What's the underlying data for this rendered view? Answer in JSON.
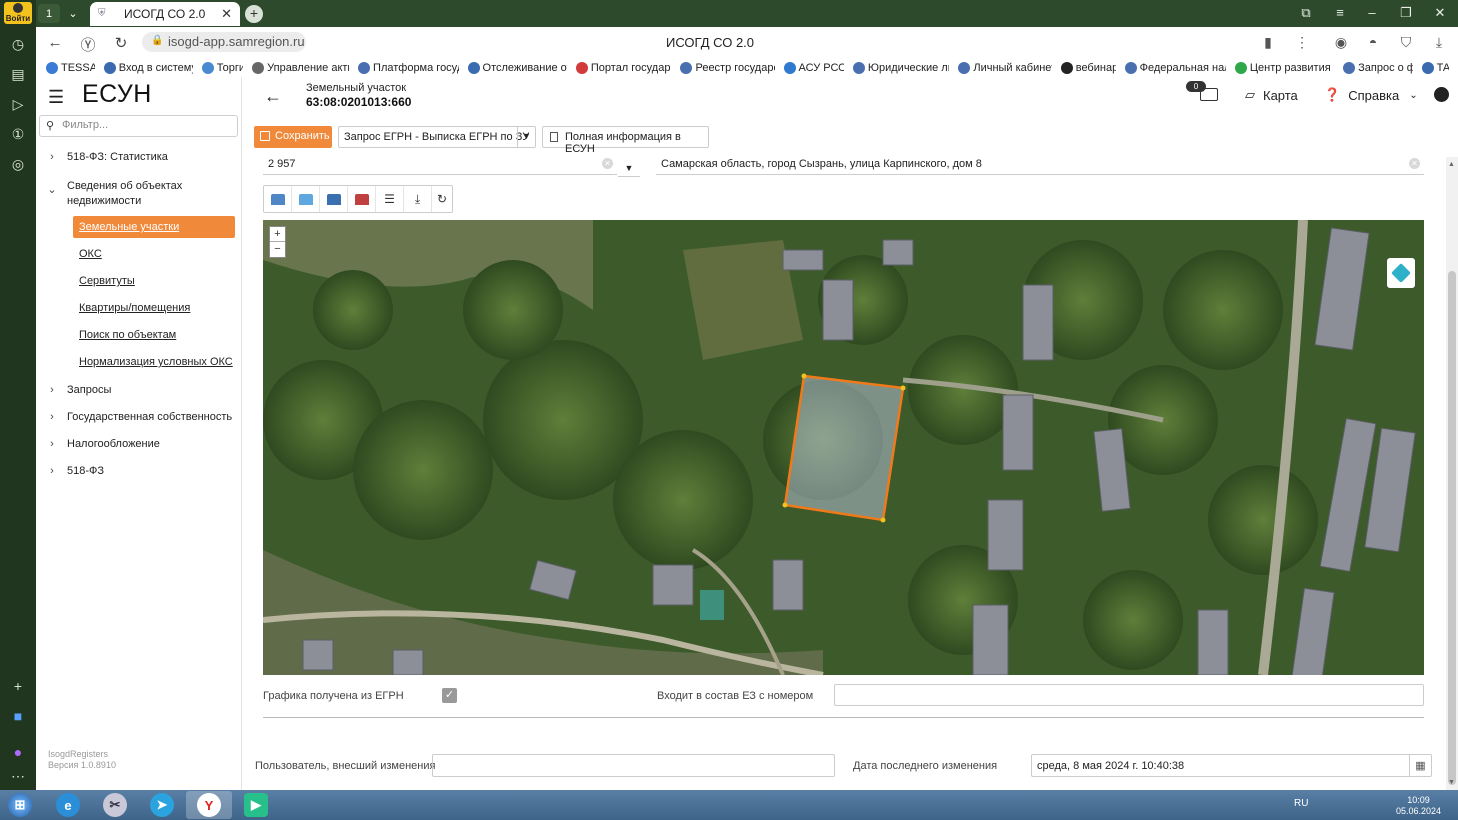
{
  "browser": {
    "login_label": "Войти",
    "tab_title": "ИСОГД СО 2.0",
    "url": "isogd-app.samregion.ru",
    "page_title": "ИСОГД СО 2.0",
    "bookmarks": [
      {
        "label": "TESSA",
        "color": "#3a7bd5"
      },
      {
        "label": "Вход в систему",
        "color": "#3a6ab0"
      },
      {
        "label": "Торги",
        "color": "#4a8ad0"
      },
      {
        "label": "Управление акти",
        "color": "#666666"
      },
      {
        "label": "Платформа госуд",
        "color": "#4a6fb0"
      },
      {
        "label": "Отслеживание от",
        "color": "#3a6ab0"
      },
      {
        "label": "Портал государс",
        "color": "#d23b3b"
      },
      {
        "label": "Реестр государс",
        "color": "#4a6fb0"
      },
      {
        "label": "АСУ РСО",
        "color": "#2f7ad0"
      },
      {
        "label": "Юридические ли",
        "color": "#4a6fb0"
      },
      {
        "label": "Личный кабинет",
        "color": "#4a6fb0"
      },
      {
        "label": "вебинар",
        "color": "#222222"
      },
      {
        "label": "Федеральная нал",
        "color": "#4a6fb0"
      },
      {
        "label": "Центр развития т",
        "color": "#2ea84a"
      },
      {
        "label": "Запрос о ф",
        "color": "#4a6fb0"
      },
      {
        "label": "ТА",
        "color": "#3a6ab0"
      }
    ]
  },
  "app": {
    "logo": "ЕСУН",
    "filter_placeholder": "Фильтр...",
    "tree": [
      {
        "label": "518-ФЗ: Статистика",
        "expanded": false
      },
      {
        "label": "Сведения об объектах недвижимости",
        "expanded": true
      },
      {
        "label": "Запросы",
        "expanded": false
      },
      {
        "label": "Государственная собственность",
        "expanded": false
      },
      {
        "label": "Налогообложение",
        "expanded": false
      },
      {
        "label": "518-ФЗ",
        "expanded": false
      }
    ],
    "subitems": [
      {
        "label": "Земельные участки",
        "active": true
      },
      {
        "label": "ОКС"
      },
      {
        "label": "Сервитуты"
      },
      {
        "label": "Квартиры/помещения"
      },
      {
        "label": "Поиск по объектам"
      },
      {
        "label": "Нормализация условных ОКС"
      }
    ],
    "version_line1": "IsogdRegisters",
    "version_line2": "Версия 1.0.8910"
  },
  "header": {
    "object_type": "Земельный участок",
    "object_number": "63:08:0201013:660",
    "mail_count": "0",
    "map_label": "Карта",
    "help_label": "Справка"
  },
  "toolbar": {
    "save_label": "Сохранить",
    "request_select": "Запрос ЕГРН - Выписка ЕГРН по ЗУ",
    "full_info_label": "Полная информация в ЕСУН"
  },
  "fields": {
    "area_value": "2 957",
    "address_value": "Самарская область, город Сызрань, улица Карпинского, дом 8",
    "graphics_label": "Графика получена из ЕГРН",
    "graphics_checked": true,
    "ez_label": "Входит в состав ЕЗ с номером",
    "ez_value": "",
    "user_label": "Пользователь, внесший изменения",
    "user_value": "",
    "date_label": "Дата последнего изменения",
    "date_value": "среда, 8 мая 2024 г. 10:40:38"
  },
  "map": {
    "zoom_in": "+",
    "zoom_out": "−",
    "parcel_color": "#f07a1a"
  },
  "taskbar": {
    "lang": "RU",
    "time": "10:09",
    "date": "05.06.2024"
  }
}
